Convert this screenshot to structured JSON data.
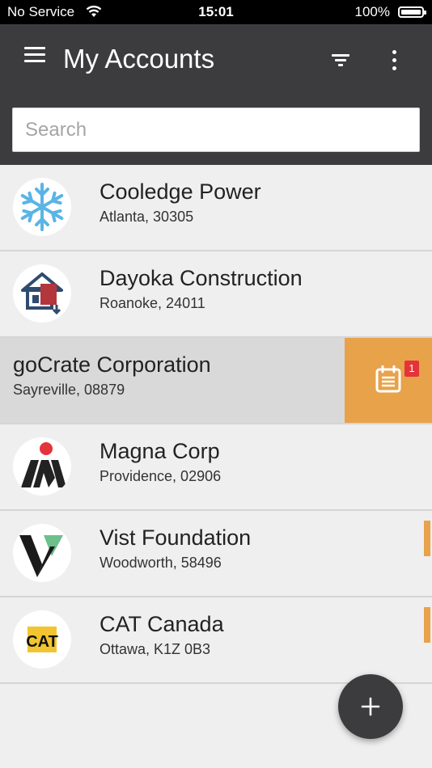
{
  "status_bar": {
    "carrier": "No Service",
    "time": "15:01",
    "battery": "100%"
  },
  "app_bar": {
    "title": "My Accounts",
    "icons": [
      "menu-icon",
      "filter-icon",
      "more-vertical-icon"
    ]
  },
  "search": {
    "placeholder": "Search",
    "value": ""
  },
  "accounts": [
    {
      "name": "Cooledge Power",
      "address": "Atlanta, 30305",
      "logo": "snowflake-logo-icon"
    },
    {
      "name": "Dayoka Construction",
      "address": "Roanoke, 24011",
      "logo": "house-logo-icon"
    },
    {
      "name": "goCrate Corporation",
      "address": "Sayreville, 08879",
      "swipe_action": {
        "icon": "calendar-icon",
        "badge": "1"
      }
    },
    {
      "name": "Magna Corp",
      "address": "Providence, 02906",
      "logo": "magna-logo-icon"
    },
    {
      "name": "Vist Foundation",
      "address": "Woodworth, 58496",
      "logo": "vist-logo-icon"
    },
    {
      "name": "CAT Canada",
      "address": "Ottawa, K1Z 0B3",
      "logo": "cat-logo-icon"
    }
  ],
  "fab": {
    "icon": "plus-icon"
  },
  "colors": {
    "app_bar": "#3c3c3f",
    "accent": "#e8a24a",
    "badge": "#e5333a",
    "background": "#efefef"
  }
}
